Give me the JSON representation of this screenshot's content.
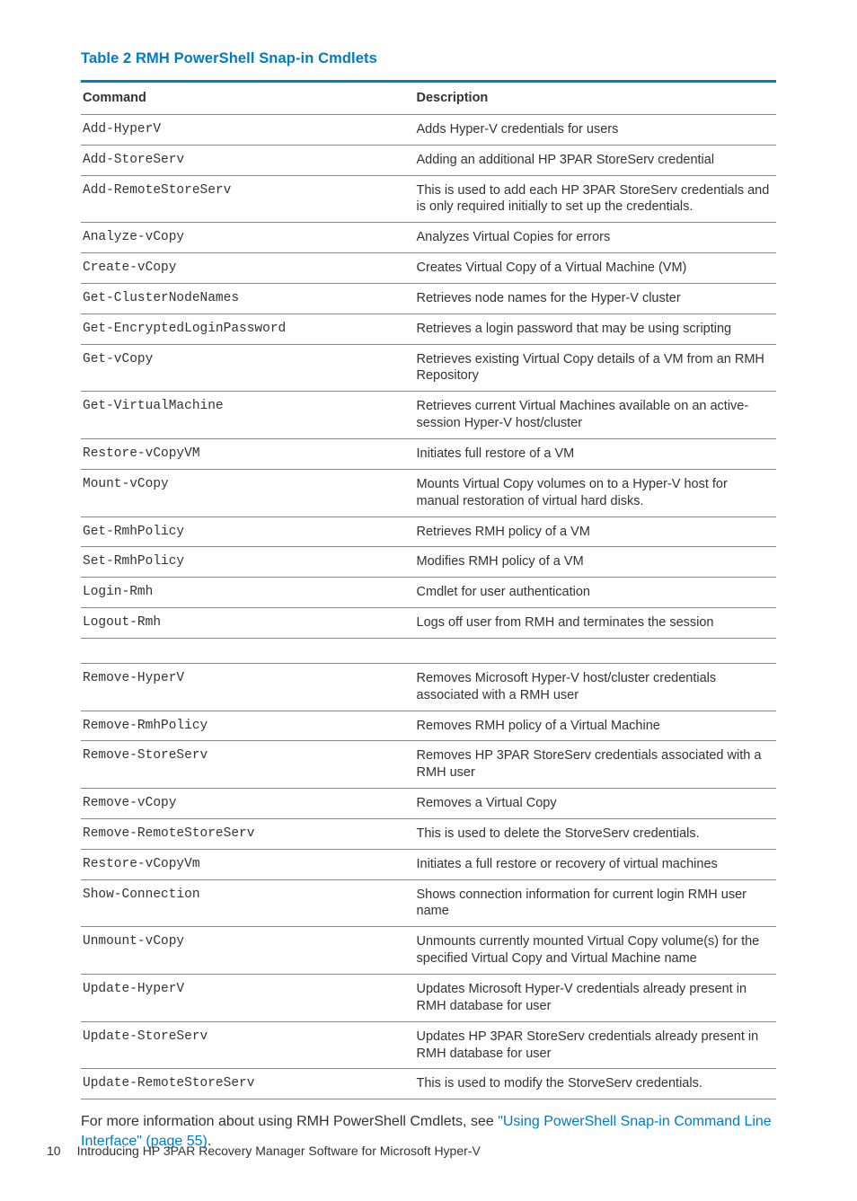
{
  "caption": "Table 2 RMH PowerShell Snap-in Cmdlets",
  "headers": {
    "command": "Command",
    "description": "Description"
  },
  "rows": [
    {
      "cmd": "Add-HyperV",
      "desc": "Adds Hyper-V credentials for users"
    },
    {
      "cmd": "Add-StoreServ",
      "desc": "Adding an additional HP 3PAR StoreServ credential"
    },
    {
      "cmd": "Add-RemoteStoreServ",
      "desc": "This is used to add each HP 3PAR StoreServ credentials and is only required initially to set up the credentials."
    },
    {
      "cmd": "Analyze-vCopy",
      "desc": "Analyzes Virtual Copies for errors"
    },
    {
      "cmd": "Create-vCopy",
      "desc": "Creates Virtual Copy of a Virtual Machine (VM)"
    },
    {
      "cmd": "Get-ClusterNodeNames",
      "desc": "Retrieves node names for the Hyper-V cluster"
    },
    {
      "cmd": "Get-EncryptedLoginPassword",
      "desc": "Retrieves a login password that may be using scripting"
    },
    {
      "cmd": "Get-vCopy",
      "desc": "Retrieves existing Virtual Copy details of a VM from an RMH Repository"
    },
    {
      "cmd": "Get-VirtualMachine",
      "desc": "Retrieves current Virtual Machines available on an active-session Hyper-V host/cluster"
    },
    {
      "cmd": "Restore-vCopyVM",
      "desc": "Initiates full restore of a VM"
    },
    {
      "cmd": "Mount-vCopy",
      "desc": "Mounts Virtual Copy volumes on to a Hyper-V host for manual restoration of virtual hard disks."
    },
    {
      "cmd": "Get-RmhPolicy",
      "desc": "Retrieves RMH policy of a VM"
    },
    {
      "cmd": "Set-RmhPolicy",
      "desc": "Modifies RMH policy of a VM"
    },
    {
      "cmd": "Login-Rmh",
      "desc": "Cmdlet for user authentication"
    },
    {
      "cmd": "Logout-Rmh",
      "desc": "Logs off user from RMH and terminates the session"
    },
    {
      "spacer": true
    },
    {
      "cmd": "Remove-HyperV",
      "desc": "Removes Microsoft Hyper-V host/cluster credentials associated with a RMH user"
    },
    {
      "cmd": "Remove-RmhPolicy",
      "desc": "Removes RMH policy of a Virtual Machine"
    },
    {
      "cmd": "Remove-StoreServ",
      "desc": "Removes HP 3PAR StoreServ credentials associated with a RMH user"
    },
    {
      "cmd": "Remove-vCopy",
      "desc": "Removes a Virtual Copy"
    },
    {
      "cmd": "Remove-RemoteStoreServ",
      "desc": "This is used to delete the StorveServ credentials."
    },
    {
      "cmd": "Restore-vCopyVm",
      "desc": "Initiates a full restore or recovery of virtual machines"
    },
    {
      "cmd": "Show-Connection",
      "desc": "Shows connection information for current login RMH user name"
    },
    {
      "cmd": "Unmount-vCopy",
      "desc": "Unmounts currently mounted Virtual Copy volume(s) for the specified Virtual Copy and Virtual Machine name"
    },
    {
      "cmd": "Update-HyperV",
      "desc": "Updates Microsoft Hyper-V credentials already present in RMH database for user"
    },
    {
      "cmd": "Update-StoreServ",
      "desc": "Updates HP 3PAR StoreServ credentials already present in RMH database for user"
    },
    {
      "cmd": "Update-RemoteStoreServ",
      "desc": "This is used to modify the StorveServ credentials."
    }
  ],
  "body_text": {
    "pre": "For more information about using RMH PowerShell Cmdlets, see ",
    "link": "\"Using PowerShell Snap-in Command Line Interface\" (page 55)",
    "post": "."
  },
  "footer": {
    "page_number": "10",
    "chapter": "Introducing HP 3PAR Recovery Manager Software for Microsoft Hyper-V"
  }
}
